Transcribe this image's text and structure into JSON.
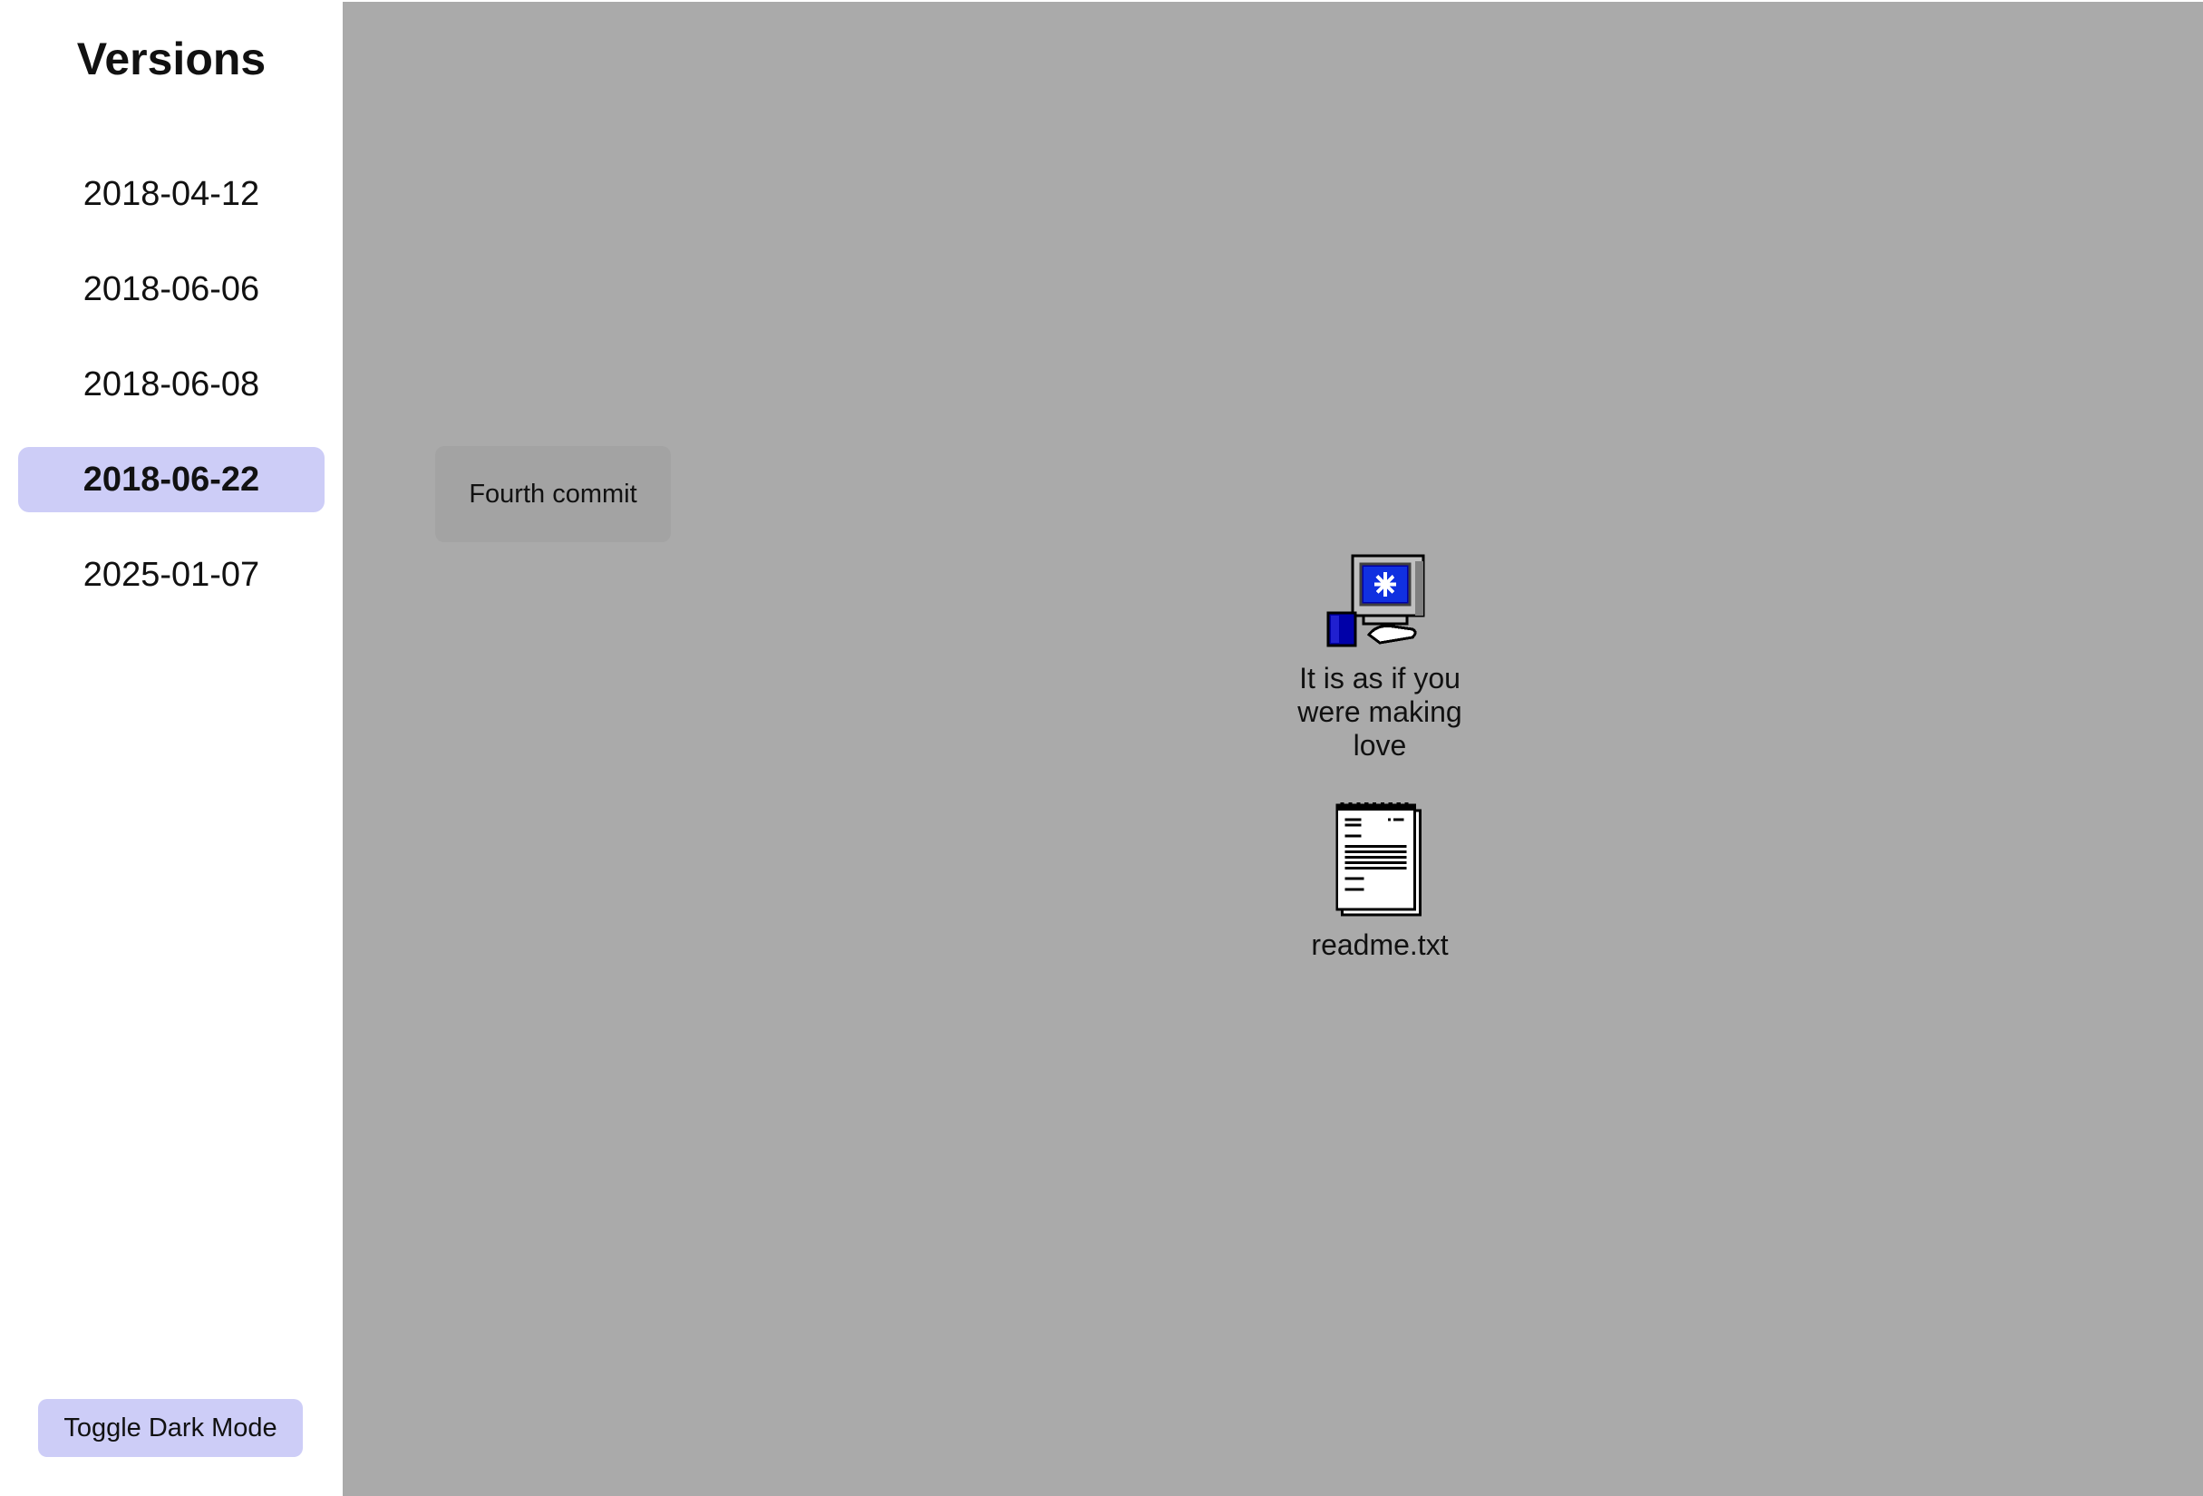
{
  "sidebar": {
    "title": "Versions",
    "versions": [
      {
        "label": "2018-04-12"
      },
      {
        "label": "2018-06-06"
      },
      {
        "label": "2018-06-08"
      },
      {
        "label": "2018-06-22",
        "active": true
      },
      {
        "label": "2025-01-07"
      }
    ],
    "toggle_label": "Toggle Dark Mode"
  },
  "desktop": {
    "commit_message": "Fourth commit",
    "icons": [
      {
        "label": "It is as if you were making love",
        "icon": "computer-icon"
      },
      {
        "label": "readme.txt",
        "icon": "notepad-icon"
      }
    ]
  },
  "colors": {
    "sidebar_bg": "#ffffff",
    "desktop_bg": "#aaaaaa",
    "accent": "#cdcdf7",
    "commit_label_bg": "#a3a3a3"
  }
}
